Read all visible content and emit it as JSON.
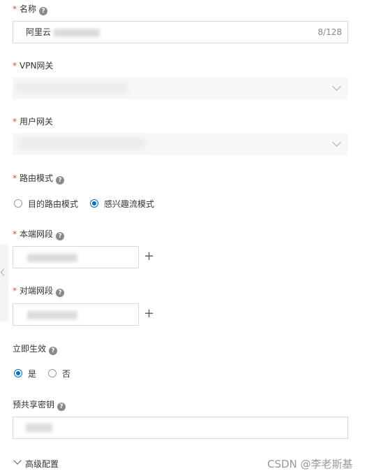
{
  "form": {
    "required_mark": "*",
    "help_glyph": "?",
    "name": {
      "label": "名称",
      "value": "阿里云",
      "counter": "8/128"
    },
    "vpn_gateway": {
      "label": "VPN网关"
    },
    "customer_gateway": {
      "label": "用户网关"
    },
    "routing_mode": {
      "label": "路由模式",
      "options": [
        "目的路由模式",
        "感兴趣流模式"
      ],
      "selected": "感兴趣流模式"
    },
    "local_cidr": {
      "label": "本端网段",
      "add_glyph": "+"
    },
    "remote_cidr": {
      "label": "对端网段",
      "add_glyph": "+"
    },
    "effective_immediately": {
      "label": "立即生效",
      "options": [
        "是",
        "否"
      ],
      "selected": "是"
    },
    "psk": {
      "label": "预共享密钥"
    },
    "advanced": {
      "label": "高级配置"
    }
  },
  "watermark": "CSDN @李老斯基",
  "colors": {
    "required": "#f04134",
    "accent": "#0070cc",
    "border": "#d9d9d9",
    "select_bg": "#f7f7f7"
  },
  "icons": [
    "help-icon",
    "chevron-down-icon",
    "plus-icon",
    "chevron-left-icon"
  ]
}
